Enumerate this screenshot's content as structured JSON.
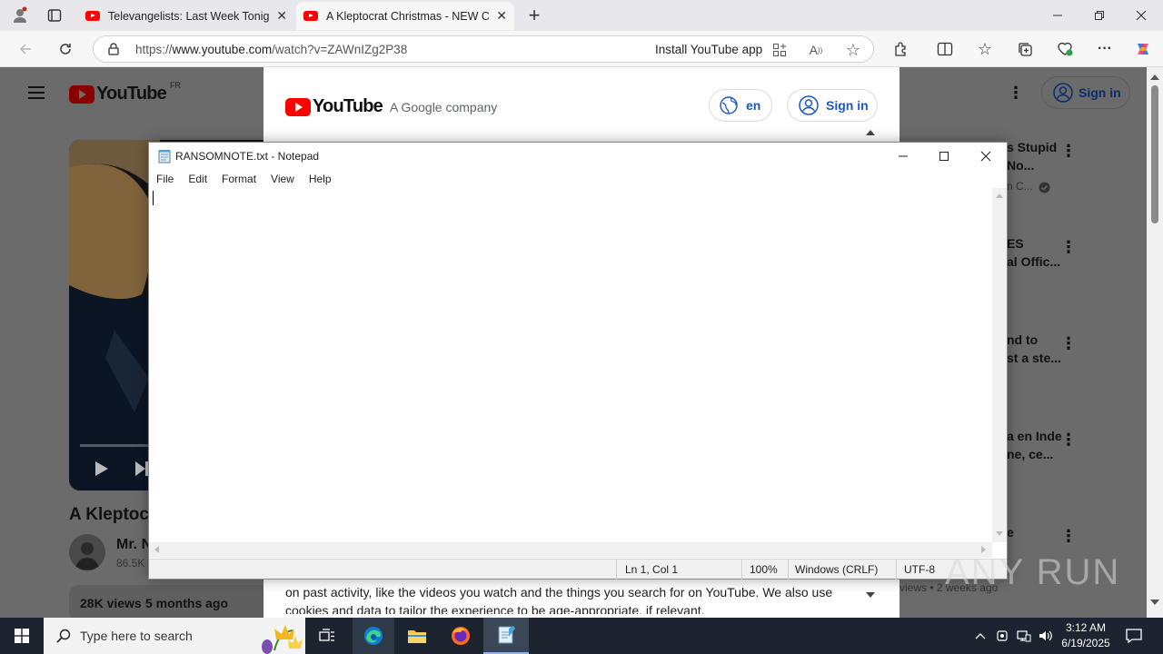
{
  "browser": {
    "tabs": [
      {
        "title": "Televangelists: Last Week Tonight",
        "active": false
      },
      {
        "title": "A Kleptocrat Christmas - NEW CH",
        "active": true
      }
    ],
    "url_prefix": "https://",
    "url_domain": "www.youtube.com",
    "url_path": "/watch?v=ZAWnIZg2P38",
    "install_app": "Install YouTube app"
  },
  "youtube": {
    "logo": "YouTube",
    "region": "FR",
    "sign_in": "Sign in",
    "video_title_partial": "A Kleptoc",
    "channel_partial": "Mr. N",
    "subs_partial": "86.5K",
    "views": "28K views",
    "age": "5 months ago",
    "sidebar": [
      {
        "line1": "s Stupid",
        "line2": "No...",
        "meta": "n C..."
      },
      {
        "line1": "ES",
        "line2": "al Offic...",
        "meta": ""
      },
      {
        "line1": "nd to",
        "line2": "st a ste...",
        "meta": ""
      },
      {
        "line1": "a en Inde",
        "line2": "ne, ce...",
        "meta": ""
      },
      {
        "line1": "e",
        "line2": "...",
        "meta": "views • 2 weeks ago"
      }
    ]
  },
  "consent": {
    "logo": "YouTube",
    "company": "A Google company",
    "lang": "en",
    "sign_in": "Sign in",
    "body_line1": "on past activity, like the videos you watch and the things you search for on YouTube. We also use",
    "body_line2": "cookies and data to tailor the experience to be age-appropriate, if relevant."
  },
  "notepad": {
    "title": "RANSOMNOTE.txt - Notepad",
    "menu": [
      "File",
      "Edit",
      "Format",
      "View",
      "Help"
    ],
    "content": "",
    "status": {
      "position": "Ln 1, Col 1",
      "zoom": "100%",
      "line_ending": "Windows (CRLF)",
      "encoding": "UTF-8"
    }
  },
  "taskbar": {
    "search_placeholder": "Type here to search",
    "time": "3:12 AM",
    "date": "6/19/2025"
  },
  "watermark": "ANY RUN"
}
